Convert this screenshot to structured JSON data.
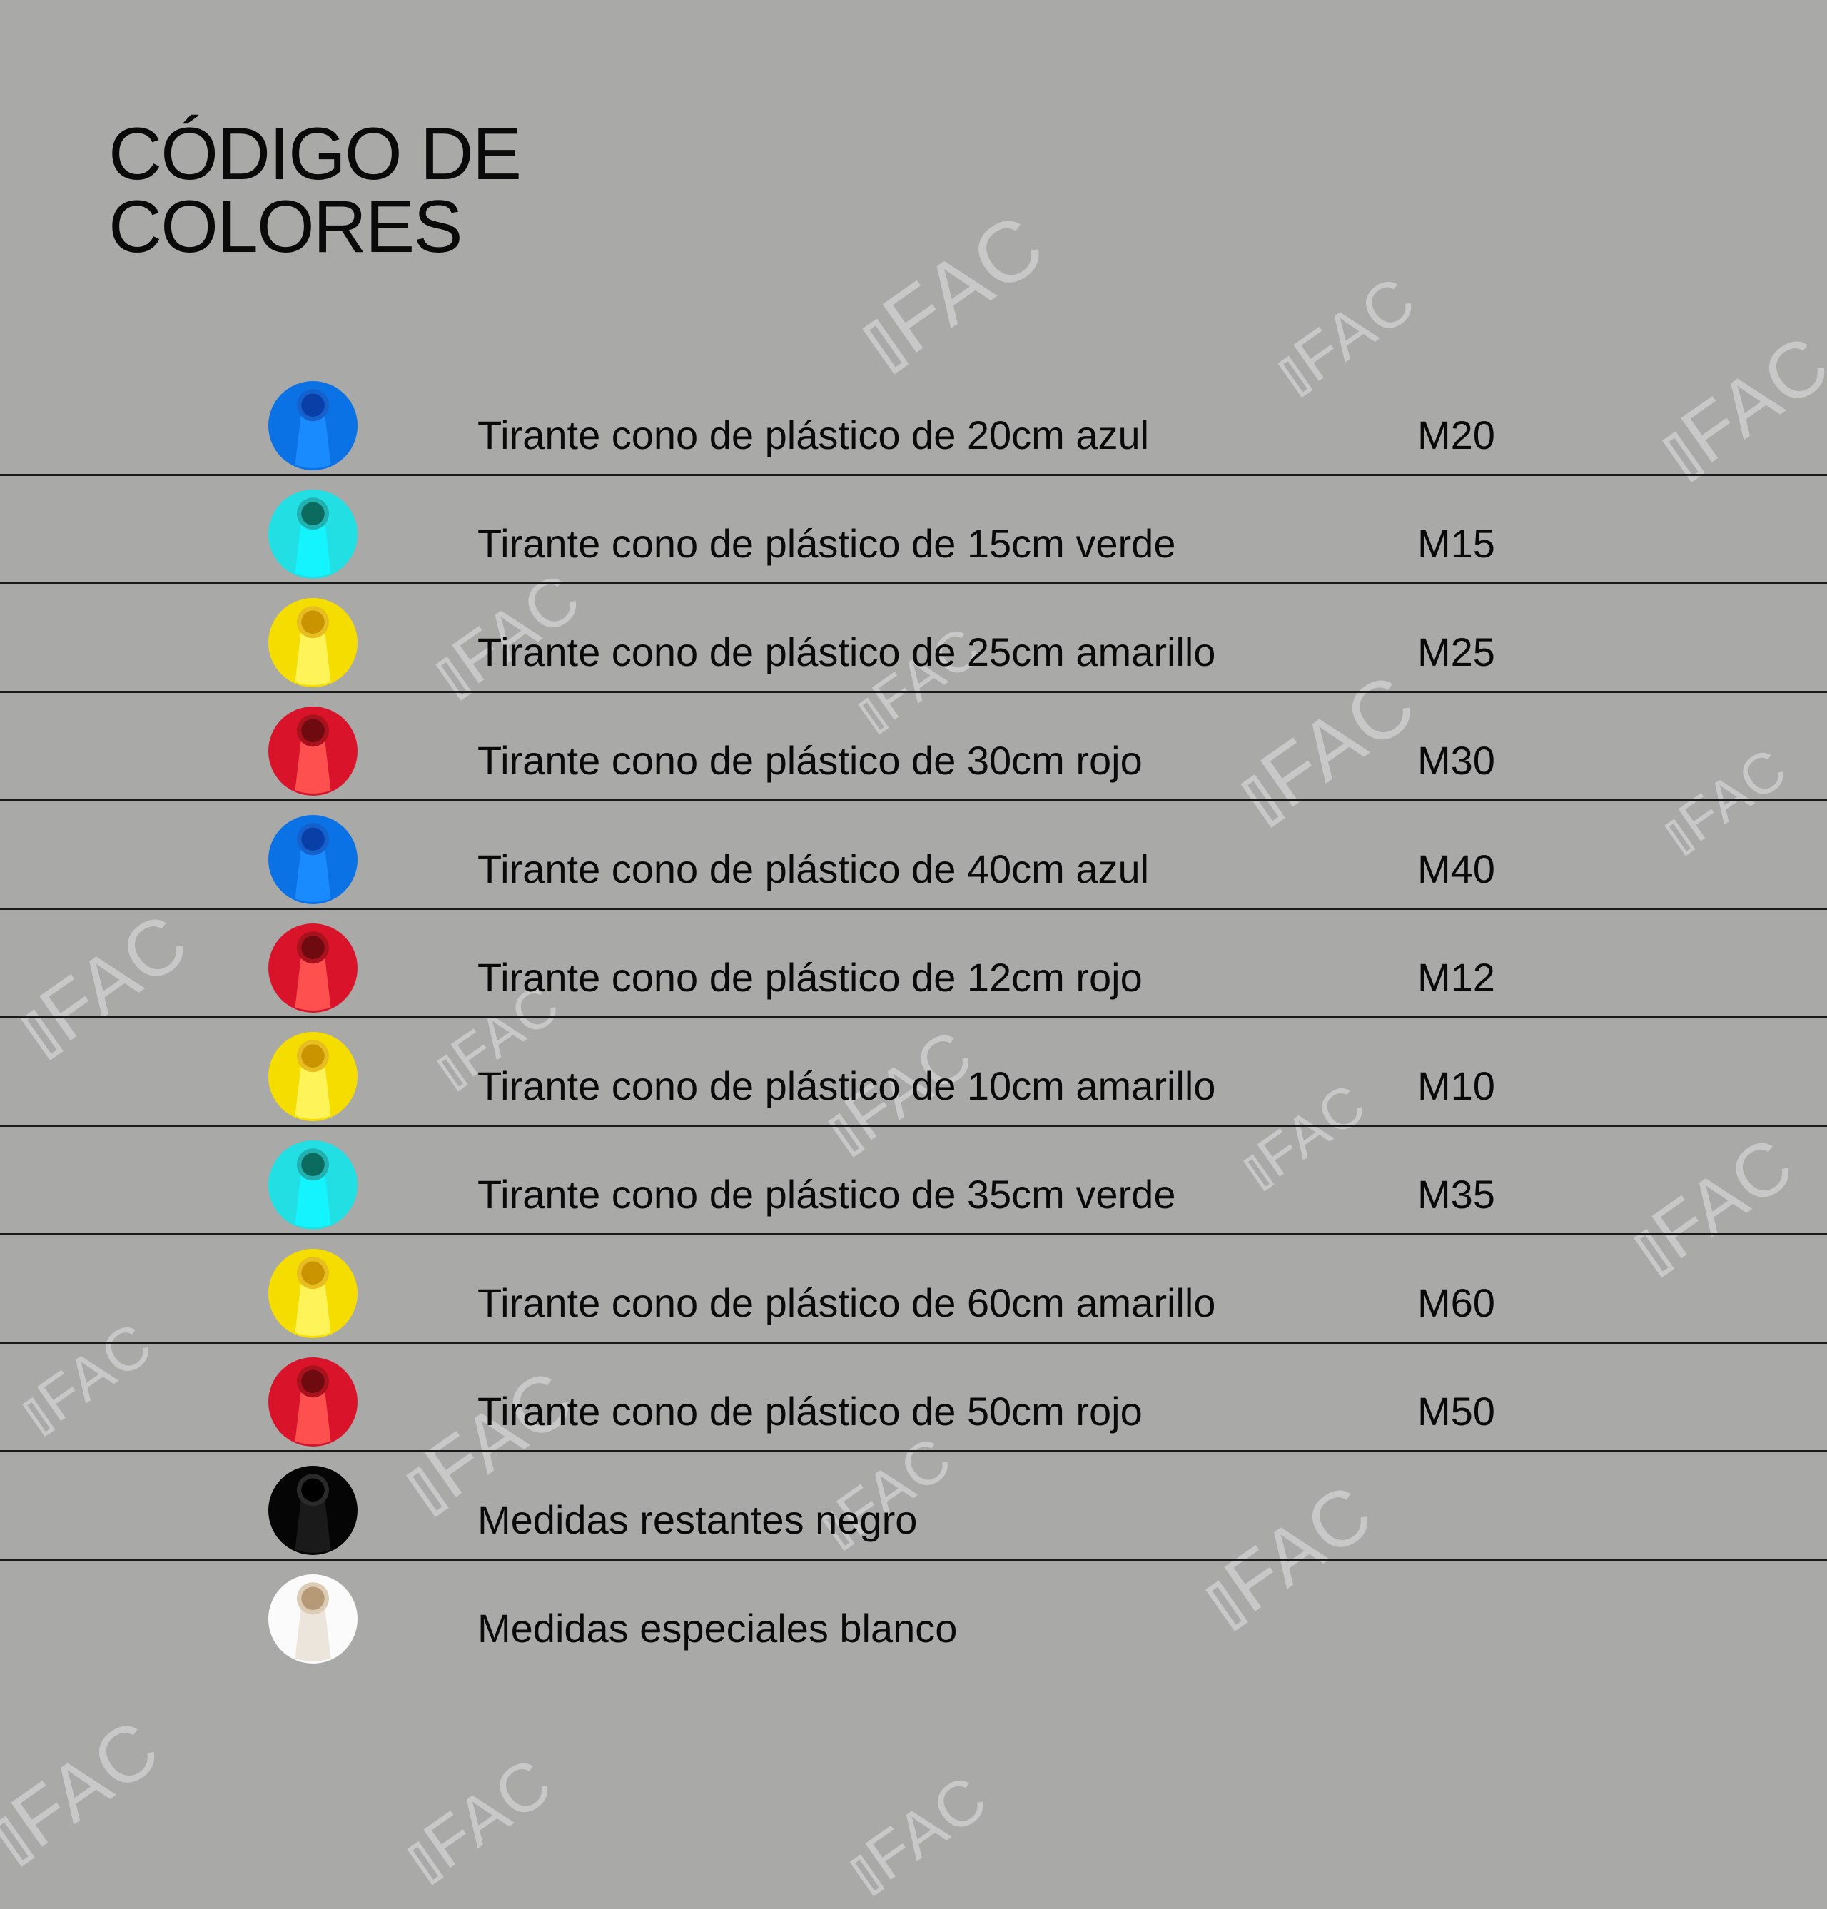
{
  "title": {
    "line1": "CÓDIGO DE",
    "line2": "COLORES"
  },
  "watermark_text": "FAC",
  "rows": [
    {
      "description": "Tirante cono de plástico de 20cm azul",
      "code": "M20",
      "color": "blue",
      "body": "#0a72e4",
      "cone": "#1a8bff",
      "hole": "#0a3fa8",
      "hole_ring": "#1461cc"
    },
    {
      "description": "Tirante cono de plástico de 15cm verde",
      "code": "M15",
      "color": "cyan",
      "body": "#21dfe2",
      "cone": "#14f4ff",
      "hole": "#0b6b5e",
      "hole_ring": "#22b0b0"
    },
    {
      "description": "Tirante cono de plástico de 25cm amarillo",
      "code": "M25",
      "color": "yellow",
      "body": "#f5dd00",
      "cone": "#fff35a",
      "hole": "#c99400",
      "hole_ring": "#e6be20"
    },
    {
      "description": "Tirante cono de plástico de 30cm rojo",
      "code": "M30",
      "color": "red",
      "body": "#d9142a",
      "cone": "#ff5050",
      "hole": "#6e0a10",
      "hole_ring": "#a8121c"
    },
    {
      "description": "Tirante cono de plástico de 40cm azul",
      "code": "M40",
      "color": "blue",
      "body": "#0a72e4",
      "cone": "#1a8bff",
      "hole": "#0a3fa8",
      "hole_ring": "#1461cc"
    },
    {
      "description": "Tirante cono de plástico de 12cm rojo",
      "code": "M12",
      "color": "red",
      "body": "#d9142a",
      "cone": "#ff5050",
      "hole": "#6e0a10",
      "hole_ring": "#a8121c"
    },
    {
      "description": "Tirante cono de plástico de 10cm amarillo",
      "code": "M10",
      "color": "yellow",
      "body": "#f5dd00",
      "cone": "#fff35a",
      "hole": "#c99400",
      "hole_ring": "#e6be20"
    },
    {
      "description": "Tirante cono de plástico de 35cm verde",
      "code": "M35",
      "color": "cyan",
      "body": "#21dfe2",
      "cone": "#14f4ff",
      "hole": "#0b6b5e",
      "hole_ring": "#22b0b0"
    },
    {
      "description": "Tirante cono de plástico de 60cm amarillo",
      "code": "M60",
      "color": "yellow",
      "body": "#f5dd00",
      "cone": "#fff35a",
      "hole": "#c99400",
      "hole_ring": "#e6be20"
    },
    {
      "description": "Tirante cono de plástico de 50cm rojo",
      "code": "M50",
      "color": "red",
      "body": "#d9142a",
      "cone": "#ff5050",
      "hole": "#6e0a10",
      "hole_ring": "#a8121c"
    },
    {
      "description": "Medidas restantes negro",
      "code": "",
      "color": "black",
      "body": "#050505",
      "cone": "#1a1a1a",
      "hole": "#000000",
      "hole_ring": "#2a2a2a"
    },
    {
      "description": "Medidas especiales blanco",
      "code": "",
      "color": "white",
      "body": "#fbfbfb",
      "cone": "#ebe5dc",
      "hole": "#b69a78",
      "hole_ring": "#dccbb5"
    }
  ]
}
